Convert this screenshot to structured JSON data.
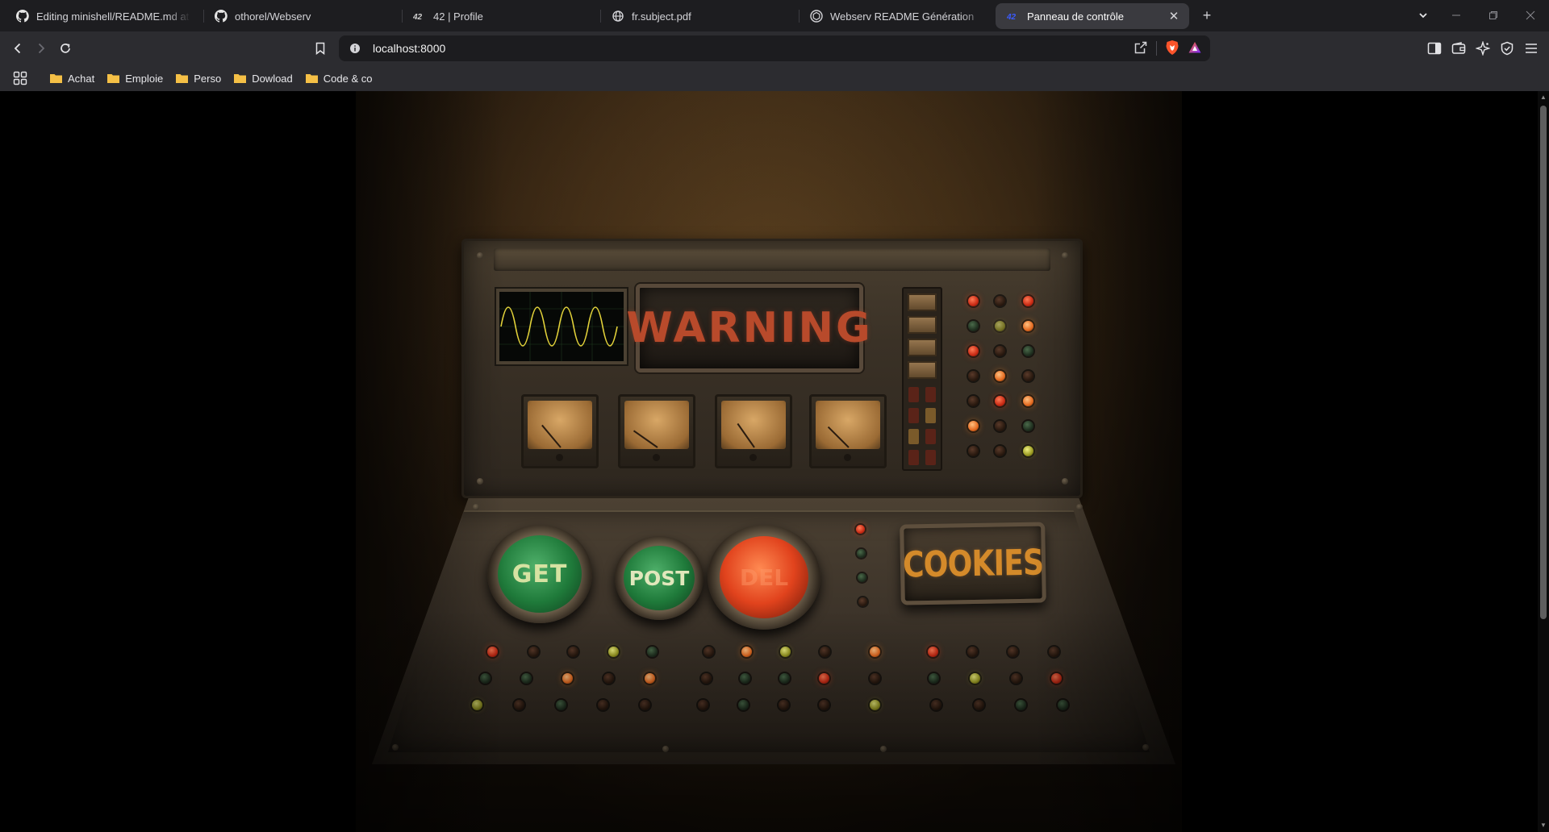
{
  "browser": {
    "tabs": [
      {
        "title": "Editing minishell/README.md at main",
        "favicon": "github-icon",
        "active": false
      },
      {
        "title": "othorel/Webserv",
        "favicon": "github-icon",
        "active": false
      },
      {
        "title": "42 | Profile",
        "favicon": "42-icon",
        "active": false
      },
      {
        "title": "fr.subject.pdf",
        "favicon": "globe-icon",
        "active": false
      },
      {
        "title": "Webserv README Génération",
        "favicon": "openai-icon",
        "active": false
      },
      {
        "title": "Panneau de contrôle",
        "favicon": "42-icon",
        "active": true
      }
    ],
    "new_tab_label": "+",
    "url": "localhost:8000",
    "bookmarks": [
      {
        "label": "Achat"
      },
      {
        "label": "Emploie"
      },
      {
        "label": "Perso"
      },
      {
        "label": "Dowload"
      },
      {
        "label": "Code & co"
      }
    ],
    "colors": {
      "tab_strip": "#1d1d20",
      "toolbar": "#2c2c30",
      "active_tab": "#3a3a3f",
      "brave_orange": "#fb542b"
    }
  },
  "page": {
    "panel": {
      "screen_label": "WARNING",
      "buttons": [
        {
          "label": "GET",
          "color": "green"
        },
        {
          "label": "POST",
          "color": "green"
        },
        {
          "label": "DEL",
          "color": "red"
        }
      ],
      "cookies_label": "COOKIES"
    }
  }
}
